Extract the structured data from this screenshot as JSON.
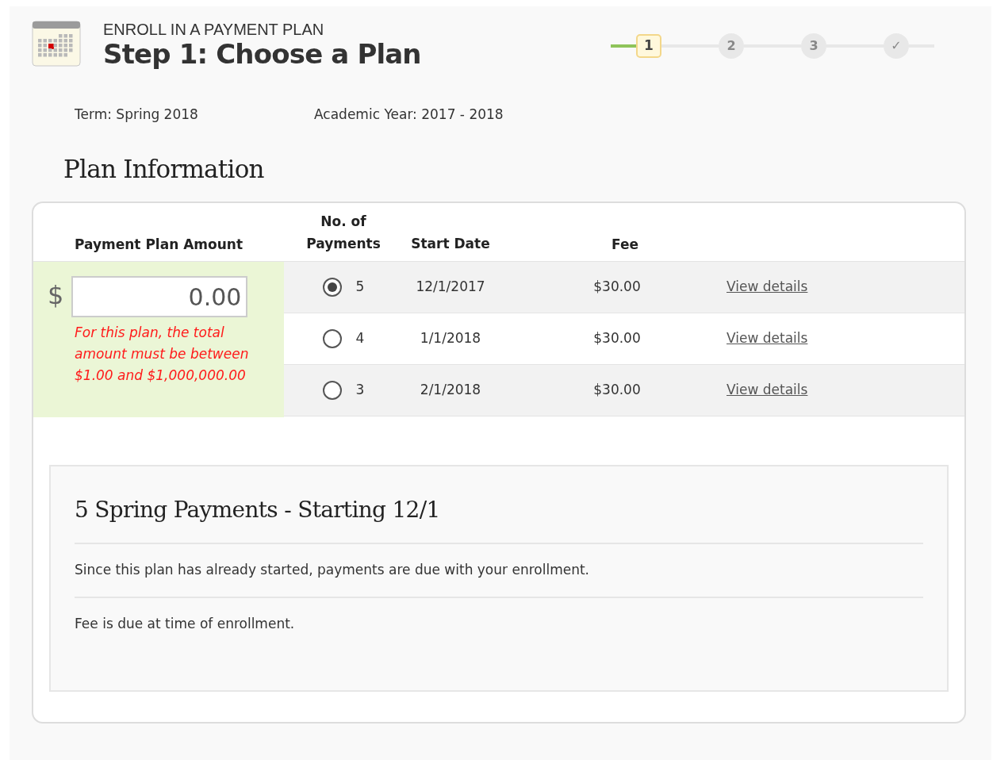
{
  "header": {
    "eyebrow": "ENROLL IN A PAYMENT PLAN",
    "title": "Step 1: Choose a Plan"
  },
  "steps": [
    {
      "label": "1",
      "current": true
    },
    {
      "label": "2",
      "current": false
    },
    {
      "label": "3",
      "current": false
    },
    {
      "label": "✓",
      "current": false
    }
  ],
  "term": {
    "term": "Term: Spring 2018",
    "year": "Academic Year: 2017 - 2018"
  },
  "section_title": "Plan Information",
  "table": {
    "columns": [
      "Payment Plan Amount",
      "No. of Payments",
      "Start Date",
      "Fee"
    ],
    "amount": {
      "currency": "$",
      "value": "0.00",
      "error": "For this plan, the total amount must be between $1.00 and $1,000,000.00"
    },
    "rows": [
      {
        "payments": "5",
        "start": "12/1/2017",
        "fee": "$30.00",
        "link": "View details",
        "selected": true
      },
      {
        "payments": "4",
        "start": "1/1/2018",
        "fee": "$30.00",
        "link": "View details",
        "selected": false
      },
      {
        "payments": "3",
        "start": "2/1/2018",
        "fee": "$30.00",
        "link": "View details",
        "selected": false
      }
    ]
  },
  "details": {
    "title": "5 Spring Payments - Starting 12/1",
    "lines": [
      "Since this plan has already started, payments are due with your enrollment.",
      "Fee is due at time of enrollment."
    ]
  }
}
